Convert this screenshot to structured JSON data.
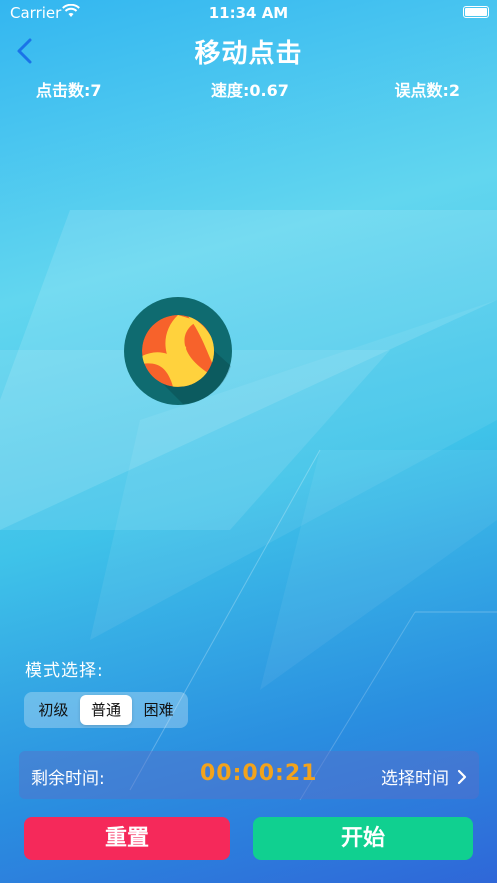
{
  "status_bar": {
    "carrier": "Carrier",
    "time": "11:34 AM"
  },
  "nav": {
    "title": "移动点击",
    "back_icon": "chevron-left-icon"
  },
  "stats": {
    "clicks": "点击数:7",
    "speed": "速度:0.67",
    "misses": "误点数:2"
  },
  "target": {
    "icon": "beach-ball-icon"
  },
  "mode": {
    "label": "模式选择:",
    "options": [
      "初级",
      "普通",
      "困难"
    ],
    "selected": "普通"
  },
  "timer": {
    "label": "剩余时间:",
    "value": "00:00:21",
    "select_label": "选择时间",
    "select_icon": "chevron-right-icon"
  },
  "buttons": {
    "reset": "重置",
    "start": "开始"
  },
  "colors": {
    "timer_value": "#f2a31c",
    "reset": "#f5295a",
    "start": "#10d090"
  }
}
